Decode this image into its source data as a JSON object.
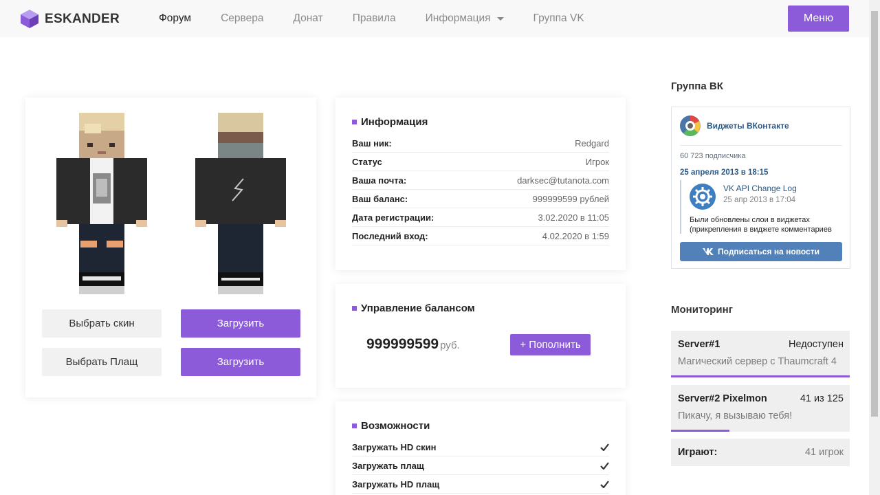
{
  "header": {
    "logo_text": "ESKANDER",
    "nav": [
      {
        "label": "Форум",
        "active": true
      },
      {
        "label": "Сервера"
      },
      {
        "label": "Донат"
      },
      {
        "label": "Правила"
      },
      {
        "label": "Информация",
        "dropdown": true
      },
      {
        "label": "Группа VK"
      }
    ],
    "menu_label": "Меню"
  },
  "skins": {
    "choose_skin": "Выбрать скин",
    "choose_cloak": "Выбрать Плащ",
    "upload_skin": "Загрузить",
    "upload_cloak": "Загрузить"
  },
  "info": {
    "title": "Информация",
    "rows": [
      {
        "key": "Ваш ник:",
        "value": "Redgard"
      },
      {
        "key": "Статус",
        "value": "Игрок"
      },
      {
        "key": "Ваша почта:",
        "value": "darksec@tutanota.com"
      },
      {
        "key": "Ваш баланс:",
        "value": "999999599 рублей"
      },
      {
        "key": "Дата регистрации:",
        "value": "3.02.2020 в 11:05"
      },
      {
        "key": "Последний вход:",
        "value": "4.02.2020 в 1:59"
      }
    ]
  },
  "balance": {
    "title": "Управление балансом",
    "amount": "999999599",
    "unit": "руб.",
    "topup_label": "Пополнить"
  },
  "features": {
    "title": "Возможности",
    "items": [
      "Загружать HD скин",
      "Загружать плащ",
      "Загружать HD плащ"
    ]
  },
  "vk": {
    "section_title": "Группа ВК",
    "group_name": "Виджеты ВКонтакте",
    "subscribers": "60 723 подписчика",
    "post_date": "25 апреля 2013 в 18:15",
    "post_title": "VK API Change Log",
    "post_time": "25 апр 2013 в 17:04",
    "post_text": "Были обновлены слои в виджетах (прикрепления в виджете комментариев",
    "subscribe_label": "Подписаться на новости"
  },
  "monitoring": {
    "title": "Мониторинг",
    "servers": [
      {
        "name": "Server#1",
        "status": "Недоступен",
        "desc": "Магический сервер с Thaumcraft 4",
        "fill": 1.0
      },
      {
        "name": "Server#2 Pixelmon",
        "status": "41 из 125",
        "desc": "Пикачу, я вызываю тебя!",
        "fill": 0.328
      }
    ],
    "online_label": "Играют:",
    "online_value": "41 игрок"
  },
  "colors": {
    "accent": "#8c5bd9",
    "vk_blue": "#5181b8"
  }
}
